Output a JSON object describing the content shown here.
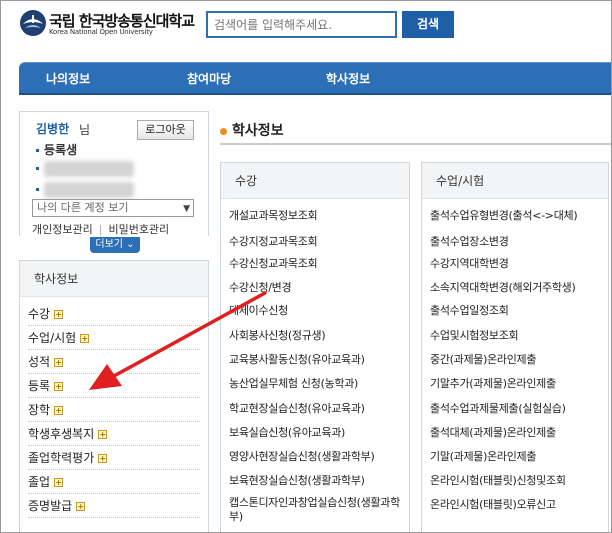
{
  "header": {
    "logo_main": "국립 한국방송통신대학교",
    "logo_sub": "Korea National Open University",
    "search_placeholder": "검색어를 입력해주세요.",
    "search_button": "검색"
  },
  "nav": {
    "items": [
      {
        "label": "나의정보"
      },
      {
        "label": "참여마당"
      },
      {
        "label": "학사정보"
      }
    ]
  },
  "user": {
    "name": "김병한",
    "suffix": "님",
    "logout": "로그아웃",
    "status": "등록생",
    "account_select": "나의 다른 계정 보기",
    "link_profile": "개인정보관리",
    "link_password": "비밀번호관리",
    "more": "더보기"
  },
  "sidemenu": {
    "title": "학사정보",
    "items": [
      {
        "label": "수강"
      },
      {
        "label": "수업/시험"
      },
      {
        "label": "성적"
      },
      {
        "label": "등록"
      },
      {
        "label": "장학"
      },
      {
        "label": "학생후생복지"
      },
      {
        "label": "졸업학력평가"
      },
      {
        "label": "졸업"
      },
      {
        "label": "증명발급"
      }
    ]
  },
  "content": {
    "title": "학사정보",
    "panels": [
      {
        "heading": "수강",
        "links": [
          "개설교과목정보조회",
          "수강지정교과목조회",
          "수강신청교과목조회",
          "수강신청/변경",
          "대체이수신청",
          "사회봉사신청(정규생)",
          "교육봉사활동신청(유아교육과)",
          "농산업실무체험 신청(농학과)",
          "학교현장실습신청(유아교육과)",
          "보육실습신청(유아교육과)",
          "영양사현장실습신청(생활과학부)",
          "보육현장실습신청(생활과학부)",
          "캡스톤디자인과창업실습신청(생활과학부)"
        ]
      },
      {
        "heading": "수업/시험",
        "links": [
          "출석수업유형변경(출석<->대체)",
          "출석수업장소변경",
          "수강지역대학변경",
          "소속지역대학변경(해외거주학생)",
          "출석수업일정조회",
          "수업및시험정보조회",
          "중간(과제물)온라인제출",
          "기말추가(과제물)온라인제출",
          "출석수업과제물제출(실험실습)",
          "출석대체(과제물)온라인제출",
          "기말(과제물)온라인제출",
          "온라인시험(태블릿)신청및조회",
          "온라인시험(태블릿)오류신고"
        ]
      }
    ]
  },
  "colors": {
    "brand_blue": "#2d6fb6",
    "accent_orange": "#f08a1c",
    "annotation_red": "#e02020"
  }
}
